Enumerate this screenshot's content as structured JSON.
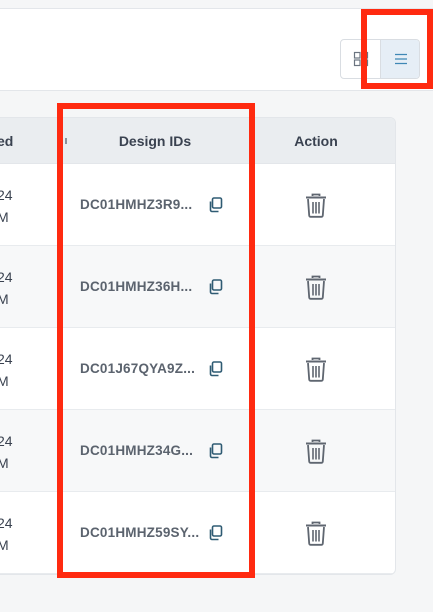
{
  "table": {
    "columns": {
      "prev": "ed",
      "design_ids": "Design IDs",
      "action": "Action"
    },
    "rows": [
      {
        "date_line1": "24",
        "date_line2": "M",
        "design_id": "DC01HMHZ3R9..."
      },
      {
        "date_line1": "24",
        "date_line2": "M",
        "design_id": "DC01HMHZ36H..."
      },
      {
        "date_line1": "24",
        "date_line2": "M",
        "design_id": "DC01J67QYA9Z..."
      },
      {
        "date_line1": "24",
        "date_line2": "M",
        "design_id": "DC01HMHZ34G..."
      },
      {
        "date_line1": "24",
        "date_line2": "M",
        "design_id": "DC01HMHZ59SY..."
      }
    ]
  },
  "view_toggle": {
    "grid_icon": "grid-view-icon",
    "list_icon": "list-view-icon",
    "active": "list"
  },
  "icons": {
    "copy": "copy-icon",
    "delete": "trash-icon"
  },
  "colors": {
    "highlight": "#ff2a10",
    "active_toggle_bg": "#e6eef6",
    "copy_icon": "#2f5b73"
  }
}
